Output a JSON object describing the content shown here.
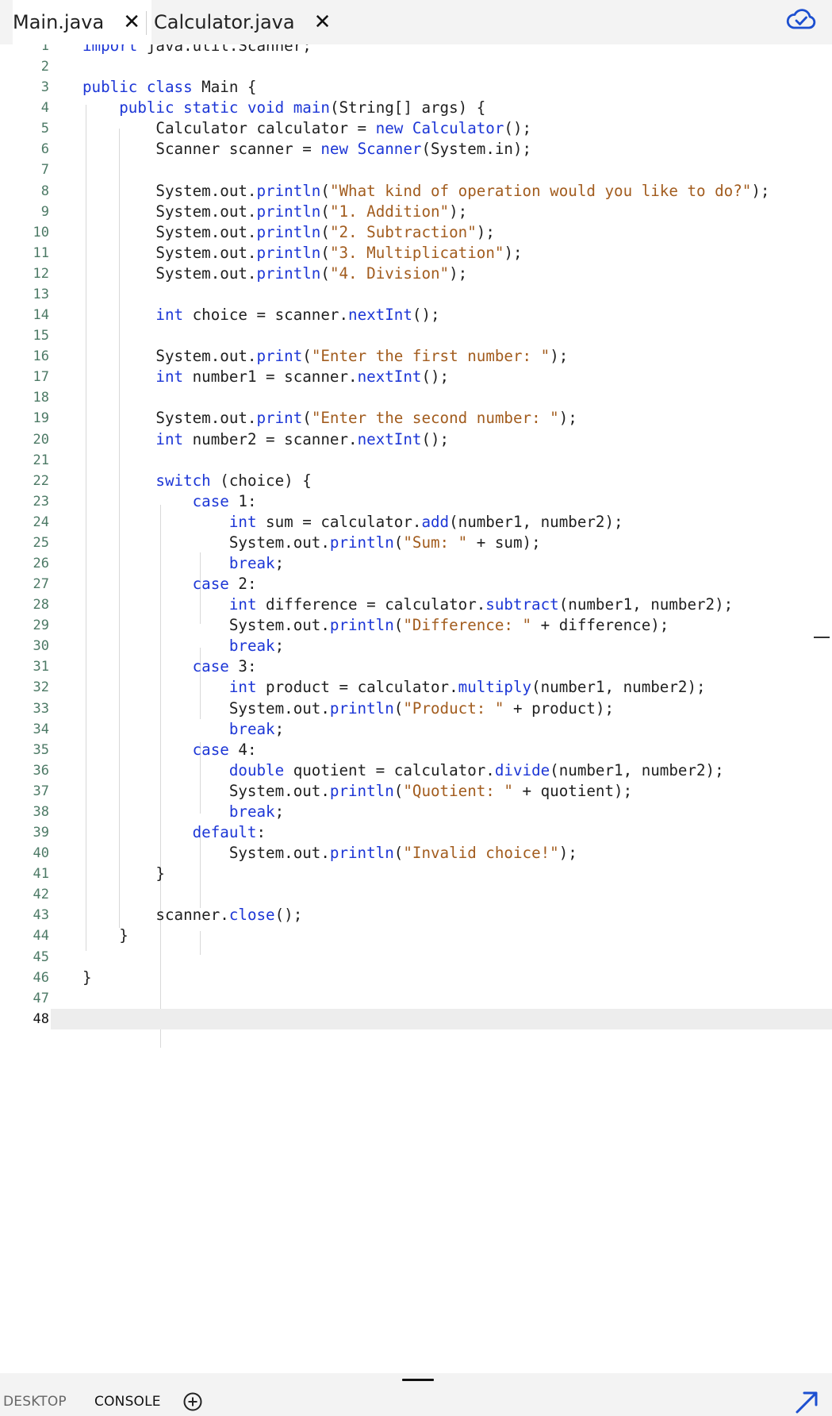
{
  "tabs": [
    {
      "label": "Main.java",
      "close": "✕",
      "active": true
    },
    {
      "label": "Calculator.java",
      "close": "✕",
      "active": false
    }
  ],
  "icons": {
    "sync": "cloud-check-icon",
    "add": "plus-circle-icon",
    "expand": "expand-arrow-icon"
  },
  "colors": {
    "keyword": "#1c36d6",
    "method": "#1c36d6",
    "string": "#a25c1e",
    "plain": "#1f1f1f",
    "line_number": "#4d7a66",
    "current_line_bg": "#ededed"
  },
  "editor": {
    "current_line": 48,
    "lines": [
      [
        [
          "k",
          "import"
        ],
        [
          "p",
          " java.util.Scanner;"
        ]
      ],
      [],
      [
        [
          "k",
          "public class"
        ],
        [
          "p",
          " Main {"
        ]
      ],
      [
        [
          "p",
          "    "
        ],
        [
          "k",
          "public static void"
        ],
        [
          "p",
          " "
        ],
        [
          "m",
          "main"
        ],
        [
          "p",
          "(String[] args) {"
        ]
      ],
      [
        [
          "p",
          "        Calculator calculator = "
        ],
        [
          "k",
          "new"
        ],
        [
          "p",
          " "
        ],
        [
          "m",
          "Calculator"
        ],
        [
          "p",
          "();"
        ]
      ],
      [
        [
          "p",
          "        Scanner scanner = "
        ],
        [
          "k",
          "new"
        ],
        [
          "p",
          " "
        ],
        [
          "m",
          "Scanner"
        ],
        [
          "p",
          "(System.in);"
        ]
      ],
      [],
      [
        [
          "p",
          "        System.out."
        ],
        [
          "m",
          "println"
        ],
        [
          "p",
          "("
        ],
        [
          "s",
          "\"What kind of operation would you like to do?\""
        ],
        [
          "p",
          ");"
        ]
      ],
      [
        [
          "p",
          "        System.out."
        ],
        [
          "m",
          "println"
        ],
        [
          "p",
          "("
        ],
        [
          "s",
          "\"1. Addition\""
        ],
        [
          "p",
          ");"
        ]
      ],
      [
        [
          "p",
          "        System.out."
        ],
        [
          "m",
          "println"
        ],
        [
          "p",
          "("
        ],
        [
          "s",
          "\"2. Subtraction\""
        ],
        [
          "p",
          ");"
        ]
      ],
      [
        [
          "p",
          "        System.out."
        ],
        [
          "m",
          "println"
        ],
        [
          "p",
          "("
        ],
        [
          "s",
          "\"3. Multiplication\""
        ],
        [
          "p",
          ");"
        ]
      ],
      [
        [
          "p",
          "        System.out."
        ],
        [
          "m",
          "println"
        ],
        [
          "p",
          "("
        ],
        [
          "s",
          "\"4. Division\""
        ],
        [
          "p",
          ");"
        ]
      ],
      [],
      [
        [
          "p",
          "        "
        ],
        [
          "k",
          "int"
        ],
        [
          "p",
          " choice = scanner."
        ],
        [
          "m",
          "nextInt"
        ],
        [
          "p",
          "();"
        ]
      ],
      [],
      [
        [
          "p",
          "        System.out."
        ],
        [
          "m",
          "print"
        ],
        [
          "p",
          "("
        ],
        [
          "s",
          "\"Enter the first number: \""
        ],
        [
          "p",
          ");"
        ]
      ],
      [
        [
          "p",
          "        "
        ],
        [
          "k",
          "int"
        ],
        [
          "p",
          " number1 = scanner."
        ],
        [
          "m",
          "nextInt"
        ],
        [
          "p",
          "();"
        ]
      ],
      [],
      [
        [
          "p",
          "        System.out."
        ],
        [
          "m",
          "print"
        ],
        [
          "p",
          "("
        ],
        [
          "s",
          "\"Enter the second number: \""
        ],
        [
          "p",
          ");"
        ]
      ],
      [
        [
          "p",
          "        "
        ],
        [
          "k",
          "int"
        ],
        [
          "p",
          " number2 = scanner."
        ],
        [
          "m",
          "nextInt"
        ],
        [
          "p",
          "();"
        ]
      ],
      [],
      [
        [
          "p",
          "        "
        ],
        [
          "k",
          "switch"
        ],
        [
          "p",
          " (choice) {"
        ]
      ],
      [
        [
          "p",
          "            "
        ],
        [
          "k",
          "case"
        ],
        [
          "p",
          " "
        ],
        [
          "n",
          "1"
        ],
        [
          "p",
          ":"
        ]
      ],
      [
        [
          "p",
          "                "
        ],
        [
          "k",
          "int"
        ],
        [
          "p",
          " sum = calculator."
        ],
        [
          "m",
          "add"
        ],
        [
          "p",
          "(number1, number2);"
        ]
      ],
      [
        [
          "p",
          "                System.out."
        ],
        [
          "m",
          "println"
        ],
        [
          "p",
          "("
        ],
        [
          "s",
          "\"Sum: \""
        ],
        [
          "p",
          " + sum);"
        ]
      ],
      [
        [
          "p",
          "                "
        ],
        [
          "k",
          "break"
        ],
        [
          "p",
          ";"
        ]
      ],
      [
        [
          "p",
          "            "
        ],
        [
          "k",
          "case"
        ],
        [
          "p",
          " "
        ],
        [
          "n",
          "2"
        ],
        [
          "p",
          ":"
        ]
      ],
      [
        [
          "p",
          "                "
        ],
        [
          "k",
          "int"
        ],
        [
          "p",
          " difference = calculator."
        ],
        [
          "m",
          "subtract"
        ],
        [
          "p",
          "(number1, number2);"
        ]
      ],
      [
        [
          "p",
          "                System.out."
        ],
        [
          "m",
          "println"
        ],
        [
          "p",
          "("
        ],
        [
          "s",
          "\"Difference: \""
        ],
        [
          "p",
          " + difference);"
        ]
      ],
      [
        [
          "p",
          "                "
        ],
        [
          "k",
          "break"
        ],
        [
          "p",
          ";"
        ]
      ],
      [
        [
          "p",
          "            "
        ],
        [
          "k",
          "case"
        ],
        [
          "p",
          " "
        ],
        [
          "n",
          "3"
        ],
        [
          "p",
          ":"
        ]
      ],
      [
        [
          "p",
          "                "
        ],
        [
          "k",
          "int"
        ],
        [
          "p",
          " product = calculator."
        ],
        [
          "m",
          "multiply"
        ],
        [
          "p",
          "(number1, number2);"
        ]
      ],
      [
        [
          "p",
          "                System.out."
        ],
        [
          "m",
          "println"
        ],
        [
          "p",
          "("
        ],
        [
          "s",
          "\"Product: \""
        ],
        [
          "p",
          " + product);"
        ]
      ],
      [
        [
          "p",
          "                "
        ],
        [
          "k",
          "break"
        ],
        [
          "p",
          ";"
        ]
      ],
      [
        [
          "p",
          "            "
        ],
        [
          "k",
          "case"
        ],
        [
          "p",
          " "
        ],
        [
          "n",
          "4"
        ],
        [
          "p",
          ":"
        ]
      ],
      [
        [
          "p",
          "                "
        ],
        [
          "k",
          "double"
        ],
        [
          "p",
          " quotient = calculator."
        ],
        [
          "m",
          "divide"
        ],
        [
          "p",
          "(number1, number2);"
        ]
      ],
      [
        [
          "p",
          "                System.out."
        ],
        [
          "m",
          "println"
        ],
        [
          "p",
          "("
        ],
        [
          "s",
          "\"Quotient: \""
        ],
        [
          "p",
          " + quotient);"
        ]
      ],
      [
        [
          "p",
          "                "
        ],
        [
          "k",
          "break"
        ],
        [
          "p",
          ";"
        ]
      ],
      [
        [
          "p",
          "            "
        ],
        [
          "k",
          "default"
        ],
        [
          "p",
          ":"
        ]
      ],
      [
        [
          "p",
          "                System.out."
        ],
        [
          "m",
          "println"
        ],
        [
          "p",
          "("
        ],
        [
          "s",
          "\"Invalid choice!\""
        ],
        [
          "p",
          ");"
        ]
      ],
      [
        [
          "p",
          "        }"
        ]
      ],
      [],
      [
        [
          "p",
          "        scanner."
        ],
        [
          "m",
          "close"
        ],
        [
          "p",
          "();"
        ]
      ],
      [
        [
          "p",
          "    }"
        ]
      ],
      [],
      [
        [
          "p",
          "}"
        ]
      ],
      [],
      []
    ]
  },
  "bottom": {
    "tabs": [
      "DESKTOP",
      "CONSOLE"
    ],
    "active": "CONSOLE"
  }
}
